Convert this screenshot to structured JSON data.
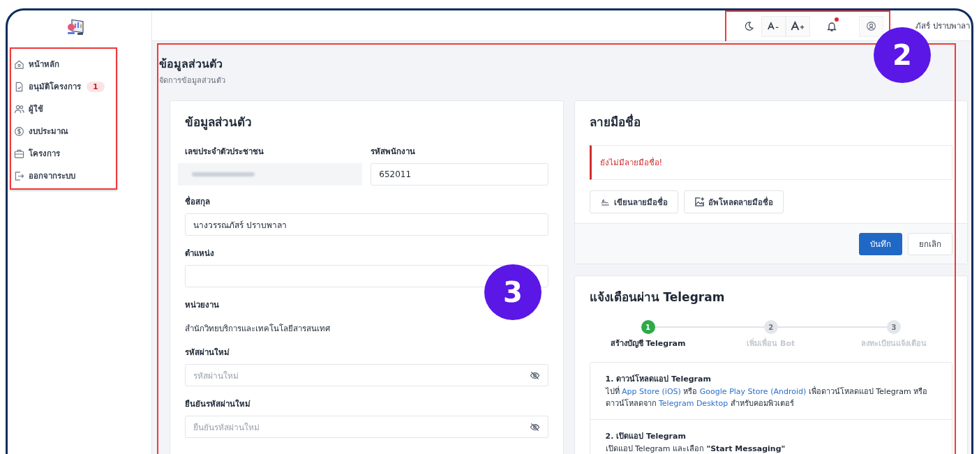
{
  "sidebar": {
    "items": [
      {
        "label": "หน้าหลัก",
        "selected": false
      },
      {
        "label": "อนุมัติโครงการ",
        "badge": "1",
        "selected": false
      },
      {
        "label": "ผู้ใช้",
        "selected": false
      },
      {
        "label": "งบประมาณ",
        "selected": false
      },
      {
        "label": "โครงการ",
        "selected": false
      },
      {
        "label": "ออกจากระบบ",
        "selected": false
      }
    ]
  },
  "topbar": {
    "notification_dot": true,
    "user_name": "ภัสร์ ปราบพาลา"
  },
  "annotations": {
    "topbar_badge": "2",
    "content_badge": "3"
  },
  "page_header": {
    "title": "ข้อมูลส่วนตัว",
    "subtitle": "จัดการข้อมูลส่วนตัว"
  },
  "profile_card": {
    "title": "ข้อมูลส่วนตัว",
    "fields": [
      {
        "label": "เลขประจำตัวประชาชน",
        "kind": "redacted"
      },
      {
        "label": "รหัสพนักงาน",
        "kind": "input",
        "value": "652011"
      },
      {
        "label": "ชื่อสกุล",
        "kind": "input",
        "value": "นางวรรณภัสร์ ปราบพาลา"
      },
      {
        "label": "ตำแหน่ง",
        "kind": "input"
      },
      {
        "label": "หน่วยงาน",
        "kind": "text",
        "value": "สำนักวิทยบริการและเทคโนโลยีสารสนเทศ"
      },
      {
        "label": "รหัสผ่านใหม่",
        "kind": "password",
        "placeholder": "รหัสผ่านใหม่"
      },
      {
        "label": "ยืนยันรหัสผ่านใหม่",
        "kind": "password",
        "placeholder": "ยืนยันรหัสผ่านใหม่"
      }
    ]
  },
  "signature_card": {
    "title": "ลายมือชื่อ",
    "alert": "ยังไม่มีลายมือชื่อ!",
    "actions": [
      "เขียนลายมือชื่อ",
      "อัพโหลดลายมือชื่อ"
    ],
    "buttons": [
      {
        "label": "บันทึก",
        "kind": "primary"
      },
      {
        "label": "ยกเลิก",
        "kind": "secondary"
      }
    ]
  },
  "telegram_card": {
    "title": "แจ้งเตือนผ่าน Telegram",
    "steps": [
      {
        "number": "1",
        "label": "สร้างบัญชี Telegram",
        "selected": true
      },
      {
        "number": "2",
        "label": "เพิ่มเพื่อน Bot",
        "selected": false
      },
      {
        "number": "3",
        "label": "ลงทะเบียนแจ้งเตือน",
        "selected": false
      }
    ],
    "instructions": [
      {
        "title": "1. ดาวน์โหลดแอป Telegram",
        "body": [
          {
            "text": "ไปที่ "
          },
          {
            "text": "App Store (iOS)",
            "link": true
          },
          {
            "text": " หรือ "
          },
          {
            "text": "Google Play Store (Android)",
            "link": true
          },
          {
            "text": " เพื่อดาวน์โหลดแอป Telegram หรือดาวน์โหลดจาก "
          },
          {
            "text": "Telegram Desktop",
            "link": true
          },
          {
            "text": " สำหรับคอมพิวเตอร์"
          }
        ]
      },
      {
        "title": "2. เปิดแอป Telegram",
        "body": [
          {
            "text": "เปิดแอป Telegram และเลือก **\"Start Messaging\"**"
          }
        ]
      }
    ]
  }
}
